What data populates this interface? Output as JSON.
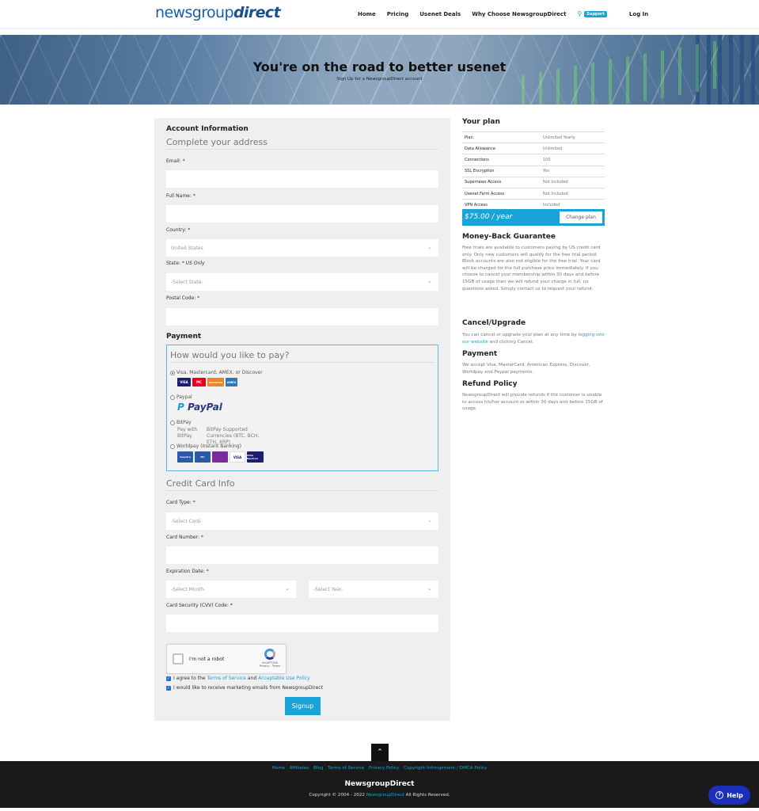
{
  "header": {
    "logo_light": "newsgroup",
    "logo_bold": "direct",
    "nav": [
      "Home",
      "Pricing",
      "Usenet Deals",
      "Why Choose NewsgroupDirect"
    ],
    "support_label": "Support",
    "login_label": "Log In"
  },
  "hero": {
    "title": "You're on the road to better usenet",
    "subtitle": "Sign Up for a NewsgroupDirect account"
  },
  "form": {
    "account_title": "Account Information",
    "address_subtitle": "Complete your address",
    "email_label": "Email: *",
    "fullname_label": "Full Name: *",
    "country_label": "Country: *",
    "country_value": "United States",
    "state_label": "State: *",
    "state_note": "US Only",
    "state_value": "-Select State-",
    "postal_label": "Postal Code: *",
    "payment_title": "Payment",
    "pay_question": "How would you like to pay?",
    "pay_options": {
      "card": "Visa, Mastercard, AMEX, or Discover",
      "paypal": "Paypal",
      "paypal_logo": "PayPal",
      "bitpay": "BitPay",
      "bitpay_img1": "Pay with BitPay",
      "bitpay_img2": "BitPay Supported Currencies (BTC, BCH, ETH, XRP)",
      "worldpay": "Worldpay (Instant Banking)"
    },
    "card_logos": {
      "visa": "VISA",
      "mastercard": "MC",
      "discover": "DISCOVER",
      "amex": "AMEX",
      "maestro": "maestro",
      "visa2": "VISA",
      "electron": "VISA Electron"
    },
    "cc_title": "Credit Card Info",
    "cardtype_label": "Card Type: *",
    "cardtype_value": "-Select Card-",
    "cardnum_label": "Card Number: *",
    "expiry_label": "Expiration Date: *",
    "month_value": "-Select Month-",
    "year_value": "-Select Year-",
    "cvv_label": "Card Security (CVV) Code: *",
    "captcha_text": "I'm not a robot",
    "captcha_brand": "reCAPTCHA",
    "captcha_links": "Privacy - Terms",
    "agree_pre": "I agree to the",
    "agree_tos": "Terms of Service",
    "agree_and": "and",
    "agree_aup": "Acceptable Use Policy",
    "marketing": "I would like to receive marketing emails from NewsgroupDirect",
    "signup_label": "Signup"
  },
  "plan": {
    "title": "Your plan",
    "rows": [
      {
        "k": "Plan",
        "v": "Unlimited Yearly"
      },
      {
        "k": "Data Allowance",
        "v": "Unlimited"
      },
      {
        "k": "Connections",
        "v": "100"
      },
      {
        "k": "SSL Encryption",
        "v": "Yes"
      },
      {
        "k": "Supernews Access",
        "v": "Not Included"
      },
      {
        "k": "Usenet.Farm Access",
        "v": "Not Included"
      },
      {
        "k": "VPN Access",
        "v": "Included"
      }
    ],
    "price": "$75.00 / year",
    "change_label": "Change plan"
  },
  "info": {
    "mbg_title": "Money-Back Guarantee",
    "mbg_text": "Free trials are available to customers paying by US credit card only. Only new customers will qualify for the free trial period. Block accounts are also not eligible for the free trial. Your card will be charged for the full purchase price immediately. If you choose to cancel your membership within 30 days and before 15GB of usage then we will refund your charge in full, no questions asked. Simply contact us to request your refund.",
    "cancel_title": "Cancel/Upgrade",
    "cancel_pre": "You can cancel or upgrade your plan at any time by",
    "cancel_link": "logging into our website",
    "cancel_post": "and clicking Cancel.",
    "payment_title": "Payment",
    "payment_text": "We accept Visa, MasterCard, American Express, Discover, Worldpay and Paypal payments.",
    "refund_title": "Refund Policy",
    "refund_text": "NewsgroupDirect will provide refunds if the customer is unable to access his/her account or within 30 days and before 15GB of usage."
  },
  "footer": {
    "links": [
      "Home",
      "Affiliates",
      "Blog",
      "Terms of Service",
      "Privacy Policy",
      "Copyright Infringement / DMCA Policy"
    ],
    "brand": "NewsgroupDirect",
    "copy_pre": "Copyright © 2004 - 2022",
    "copy_link": "NewsgroupDirect",
    "copy_post": "All Rights Reserved.",
    "help_label": "Help"
  },
  "colors": {
    "accent": "#1aa3d8",
    "logo": "#1a5ea8",
    "footer": "#1a1a1a",
    "help": "#1c2fb8"
  }
}
